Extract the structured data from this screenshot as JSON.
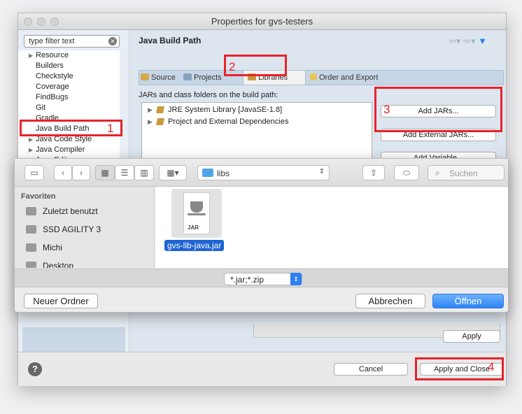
{
  "window": {
    "title": "Properties for gvs-testers"
  },
  "sidebar": {
    "filter_placeholder": "type filter text",
    "items": [
      {
        "label": "Resource",
        "expandable": true
      },
      {
        "label": "Builders",
        "expandable": false
      },
      {
        "label": "Checkstyle",
        "expandable": false
      },
      {
        "label": "Coverage",
        "expandable": false
      },
      {
        "label": "FindBugs",
        "expandable": false
      },
      {
        "label": "Git",
        "expandable": false
      },
      {
        "label": "Gradle",
        "expandable": false
      },
      {
        "label": "Java Build Path",
        "expandable": false,
        "selected": true
      },
      {
        "label": "Java Code Style",
        "expandable": true
      },
      {
        "label": "Java Compiler",
        "expandable": true
      },
      {
        "label": "Java Editor",
        "expandable": true
      }
    ]
  },
  "main": {
    "title": "Java Build Path",
    "tabs": [
      {
        "label": "Source"
      },
      {
        "label": "Projects"
      },
      {
        "label": "Libraries",
        "active": true
      },
      {
        "label": "Order and Export"
      }
    ],
    "description": "JARs and class folders on the build path:",
    "entries": [
      {
        "label": "JRE System Library [JavaSE-1.8]"
      },
      {
        "label": "Project and External Dependencies"
      }
    ],
    "buttons": {
      "add_jars": "Add JARs...",
      "add_external_jars": "Add External JARs...",
      "add_variable": "Add Variable...",
      "apply": "Apply"
    }
  },
  "footer": {
    "cancel": "Cancel",
    "apply_and_close": "Apply and Close"
  },
  "annotations": [
    "1",
    "2",
    "3",
    "4"
  ],
  "file_dialog": {
    "path": "libs",
    "search_placeholder": "Suchen",
    "favorites_header": "Favoriten",
    "favorites": [
      "Zuletzt benutzt",
      "SSD AGILITY 3",
      "Michi",
      "Desktop"
    ],
    "files": [
      {
        "name": "gvs-lib-java.jar",
        "badge": "JAR",
        "selected": true
      }
    ],
    "file_type": "*.jar;*.zip",
    "buttons": {
      "new_folder": "Neuer Ordner",
      "cancel": "Abbrechen",
      "open": "Öffnen"
    }
  },
  "colors": {
    "annotation": "#e8232a",
    "accent": "#2d7ff0",
    "selection": "#1e64d2"
  }
}
